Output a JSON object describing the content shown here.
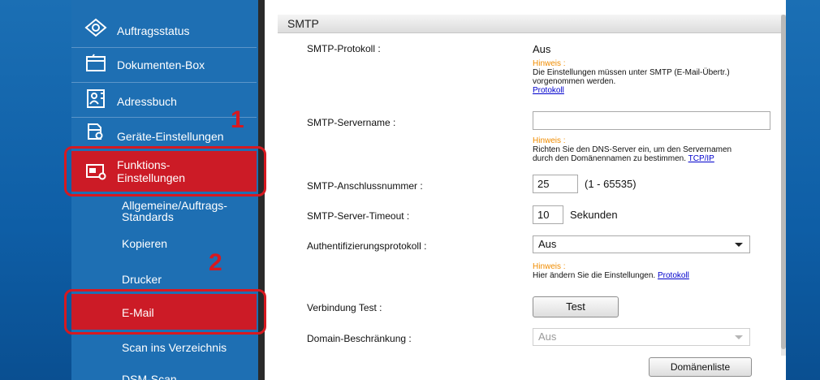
{
  "sidebar": {
    "items": [
      {
        "label": "Auftragsstatus",
        "icon": "eye-icon"
      },
      {
        "label": "Dokumenten-Box",
        "icon": "folder-box-icon"
      },
      {
        "label": "Adressbuch",
        "icon": "address-book-icon"
      },
      {
        "label": "Geräte-Einstellungen",
        "icon": "device-settings-icon"
      },
      {
        "label_line1": "Funktions-",
        "label_line2": "Einstellungen",
        "icon": "function-settings-icon"
      }
    ],
    "subitems": [
      {
        "label_line1": "Allgemeine/Auftrags-",
        "label_line2": "Standards"
      },
      {
        "label": "Kopieren"
      },
      {
        "label": "Drucker"
      },
      {
        "label": "E-Mail"
      },
      {
        "label": "Scan ins Verzeichnis"
      },
      {
        "label": "DSM-Scan"
      }
    ]
  },
  "callouts": {
    "step1": "1",
    "step2": "2"
  },
  "panel": {
    "title": "SMTP",
    "smtp_protocol": {
      "label": "SMTP-Protokoll :",
      "value": "Aus",
      "hint_title": "Hinweis :",
      "hint_text_1": "Die Einstellungen müssen unter SMTP (E-Mail-Übertr.)",
      "hint_text_2": "vorgenommen werden.",
      "hint_link": "Protokoll"
    },
    "smtp_server": {
      "label": "SMTP-Servername :",
      "value": "",
      "hint_title": "Hinweis :",
      "hint_text_1": "Richten Sie den DNS-Server ein, um den Servernamen",
      "hint_text_2": "durch den Domänennamen zu bestimmen.",
      "hint_link": "TCP/IP"
    },
    "smtp_port": {
      "label": "SMTP-Anschlussnummer :",
      "value": "25",
      "range": "(1 - 65535)"
    },
    "smtp_timeout": {
      "label": "SMTP-Server-Timeout :",
      "value": "10",
      "unit": "Sekunden"
    },
    "auth_protocol": {
      "label": "Authentifizierungsprotokoll :",
      "value": "Aus",
      "hint_title": "Hinweis :",
      "hint_text": "Hier ändern Sie die Einstellungen.",
      "hint_link": "Protokoll"
    },
    "connection_test": {
      "label": "Verbindung Test :",
      "button": "Test"
    },
    "domain_restriction": {
      "label": "Domain-Beschränkung :",
      "value": "Aus",
      "button": "Domänenliste"
    }
  },
  "colors": {
    "sidebar_bg": "#1e6fb3",
    "active": "#cc1b26",
    "callout": "#d71920",
    "hint": "#f08c00"
  }
}
